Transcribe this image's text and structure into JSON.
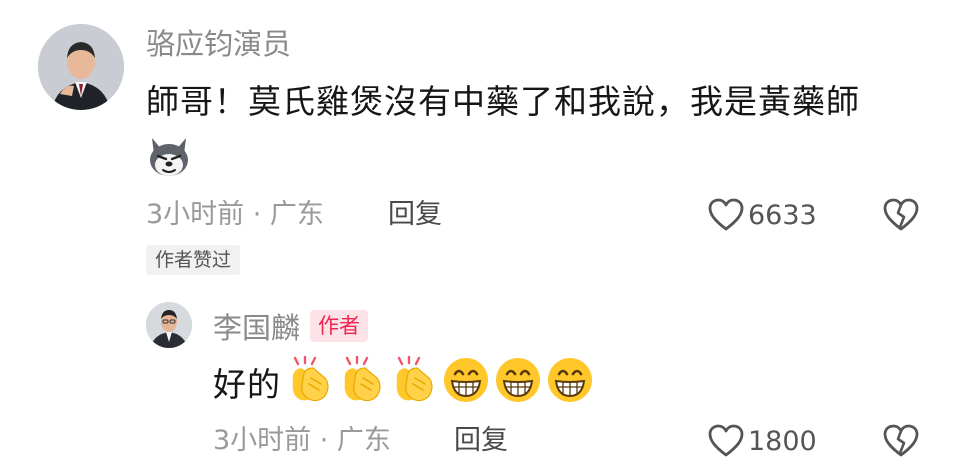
{
  "comment": {
    "author": "骆应钧演员",
    "text": "師哥！莫氏雞煲沒有中藥了和我說，我是黃藥師",
    "sticker_icon": "husky-emoji-icon",
    "time_location": "3小时前 · 广东",
    "reply_label": "回复",
    "like_count": "6633",
    "author_liked_badge": "作者赞过"
  },
  "reply": {
    "author": "李国麟",
    "author_tag": "作者",
    "text": "好的",
    "emojis": [
      "clapping-hands-icon",
      "clapping-hands-icon",
      "clapping-hands-icon",
      "grinning-face-icon",
      "grinning-face-icon",
      "grinning-face-icon"
    ],
    "time_location": "3小时前 · 广东",
    "reply_label": "回复",
    "like_count": "1800"
  },
  "colors": {
    "author_tag_bg": "#fde3e8",
    "author_tag_text": "#f0254f",
    "emoji_yellow": "#ffc72a"
  }
}
